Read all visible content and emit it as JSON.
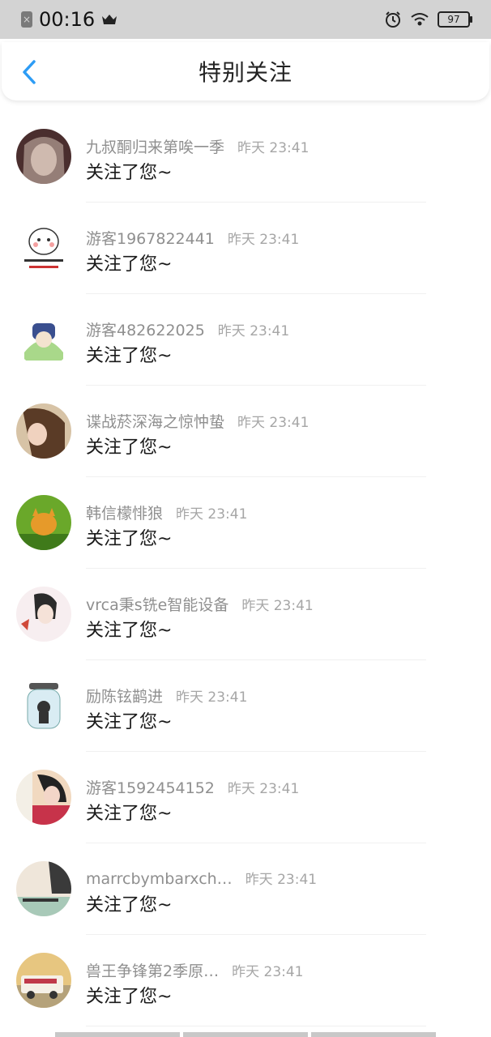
{
  "status_bar": {
    "time": "00:16",
    "battery": "97",
    "icons": [
      "sim-off-icon",
      "crown-icon",
      "alarm-icon",
      "wifi-icon",
      "battery-icon"
    ]
  },
  "header": {
    "title": "特别关注",
    "back_icon": "chevron-left-icon",
    "accent_color": "#2d9cf5"
  },
  "items": [
    {
      "name": "九叔酮归来第唉一季",
      "time": "昨天 23:41",
      "message": "关注了您~",
      "avatar_color": "#5a3b3b"
    },
    {
      "name": "游客1967822441",
      "time": "昨天 23:41",
      "message": "关注了您~",
      "avatar_color": "#ffffff"
    },
    {
      "name": "游客482622025",
      "time": "昨天 23:41",
      "message": "关注了您~",
      "avatar_color": "#bfe3a6"
    },
    {
      "name": "谍战菸深海之惊忡蛰",
      "time": "昨天 23:41",
      "message": "关注了您~",
      "avatar_color": "#c9a27a"
    },
    {
      "name": "韩信檬悱狼",
      "time": "昨天 23:41",
      "message": "关注了您~",
      "avatar_color": "#e3a02b"
    },
    {
      "name": "vrca秉s铣e智能设备",
      "time": "昨天 23:41",
      "message": "关注了您~",
      "avatar_color": "#f3e3e6"
    },
    {
      "name": "励陈铉鹋进",
      "time": "昨天 23:41",
      "message": "关注了您~",
      "avatar_color": "#cfe4ee"
    },
    {
      "name": "游客1592454152",
      "time": "昨天 23:41",
      "message": "关注了您~",
      "avatar_color": "#d84a5a"
    },
    {
      "name": "marrcbymbarxch…",
      "time": "昨天 23:41",
      "message": "关注了您~",
      "avatar_color": "#8b7f73"
    },
    {
      "name": "兽王争锋第2季原…",
      "time": "昨天 23:41",
      "message": "关注了您~",
      "avatar_color": "#d9b24a"
    }
  ]
}
